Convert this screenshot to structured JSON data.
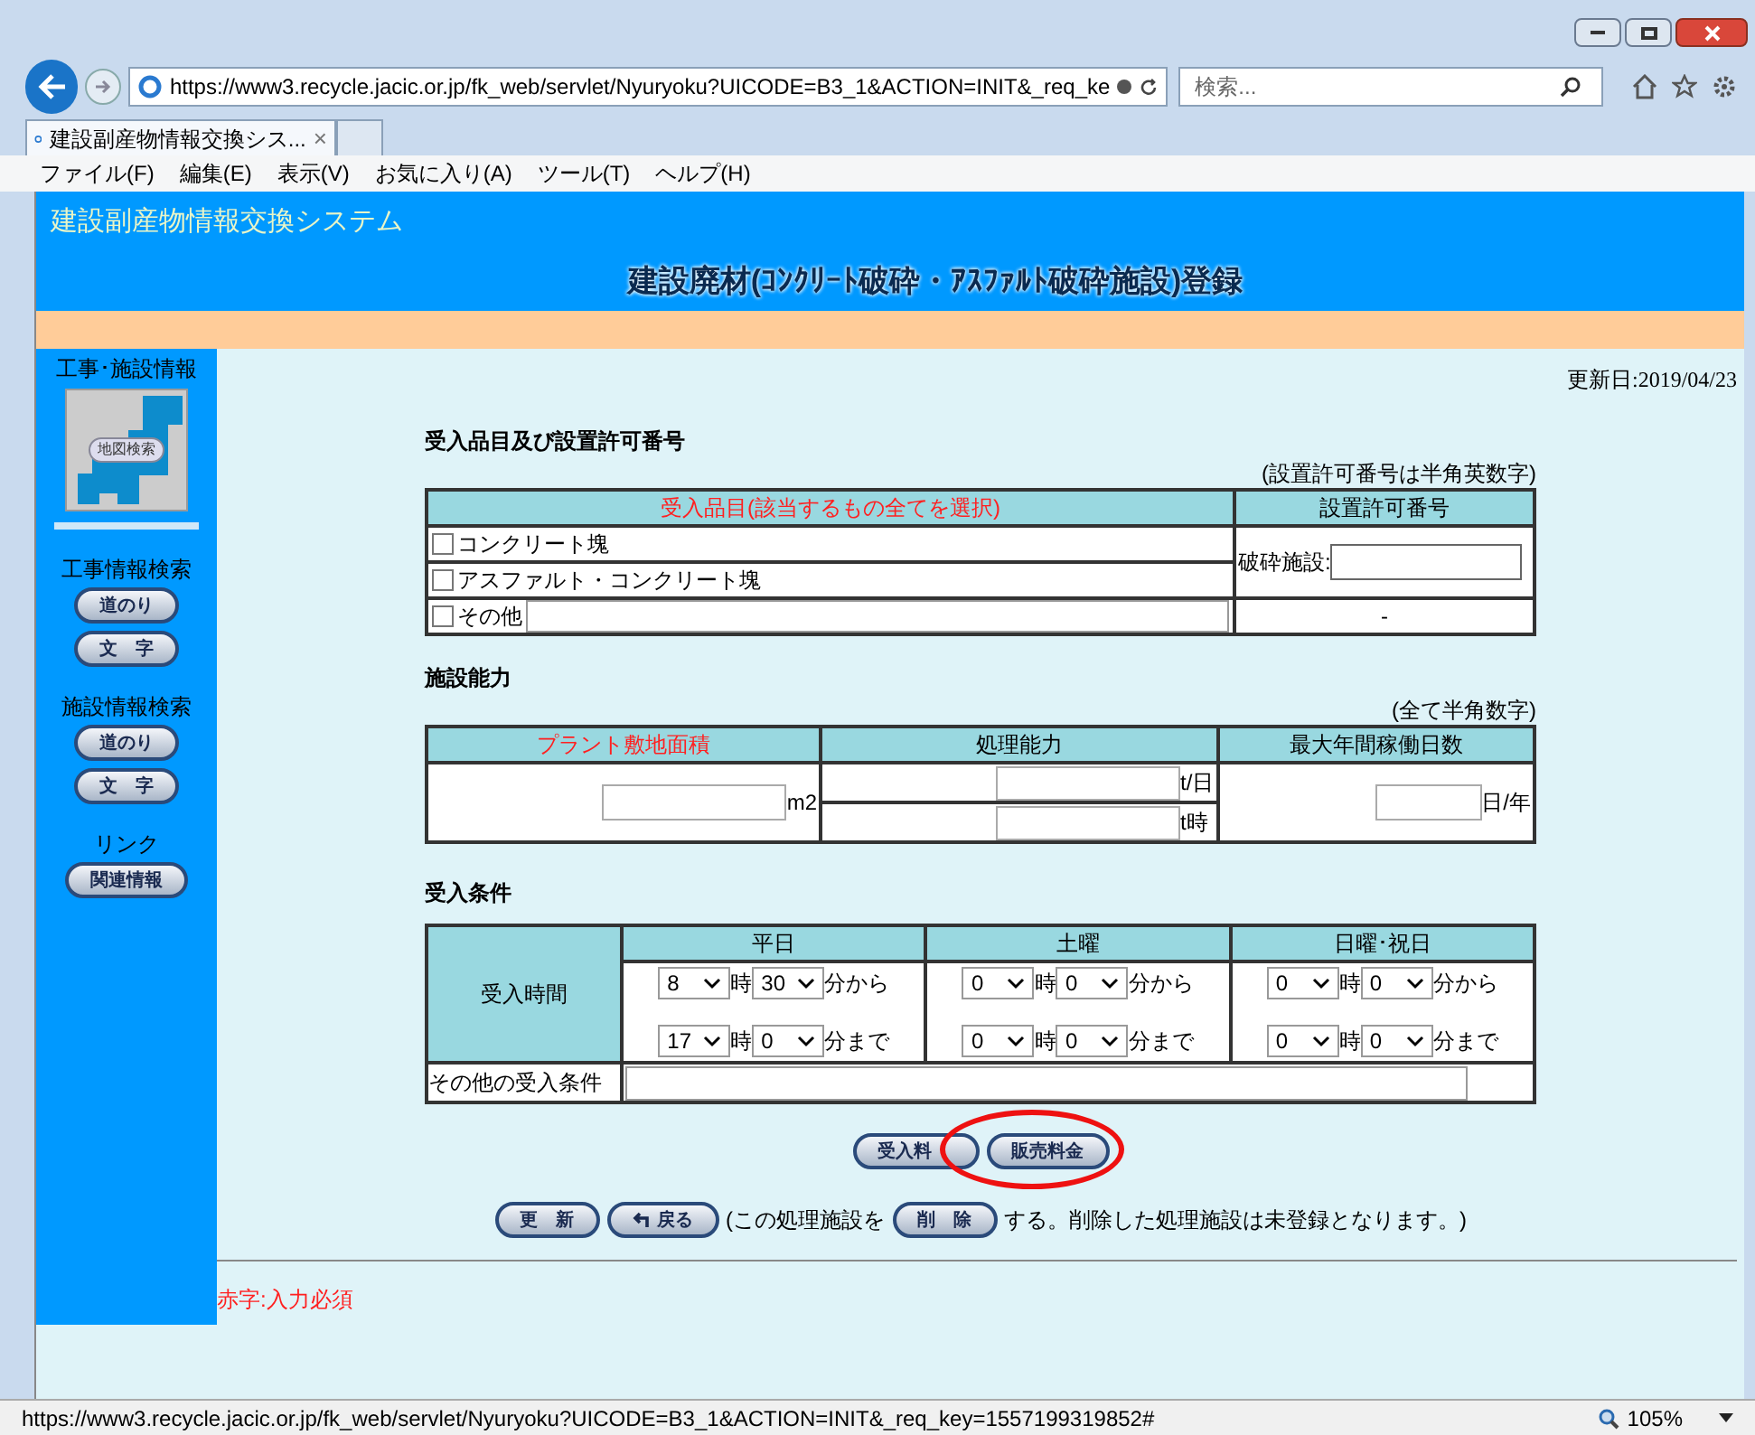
{
  "browser": {
    "address": "https://www3.recycle.jacic.or.jp/fk_web/servlet/Nyuryoku?UICODE=B3_1&ACTION=INIT&_req_ke",
    "search_placeholder": "検索...",
    "tab_title": "建設副産物情報交換シス...",
    "tab_close": "×",
    "menu": [
      "ファイル(F)",
      "編集(E)",
      "表示(V)",
      "お気に入り(A)",
      "ツール(T)",
      "ヘルプ(H)"
    ],
    "status_url": "https://www3.recycle.jacic.or.jp/fk_web/servlet/Nyuryoku?UICODE=B3_1&ACTION=INIT&_req_key=1557199319852#",
    "zoom": "105%"
  },
  "page": {
    "system_title": "建設副産物情報交換システム",
    "page_title": "建設廃材(ｺﾝｸﾘｰﾄ破砕・ｱｽﾌｧﾙﾄ破砕施設)登録",
    "updated": "更新日:2019/04/23"
  },
  "sidebar": {
    "heading": "工事･施設情報",
    "map_button": "地図検索",
    "groups": [
      {
        "title": "工事情報検索",
        "buttons": [
          "道のり",
          "文　字"
        ]
      },
      {
        "title": "施設情報検索",
        "buttons": [
          "道のり",
          "文　字"
        ]
      },
      {
        "title": "リンク",
        "buttons": [
          "関連情報"
        ]
      }
    ]
  },
  "items_section": {
    "title": "受入品目及び設置許可番号",
    "note": "(設置許可番号は半角英数字)",
    "columns": [
      {
        "label": "受入品目(該当するもの全てを選択)",
        "required": true
      },
      {
        "label": "設置許可番号",
        "required": false
      }
    ],
    "items": [
      {
        "label": "コンクリート塊",
        "checked": false,
        "kind": "plain"
      },
      {
        "label": "アスファルト・コンクリート塊",
        "checked": false,
        "kind": "plain"
      },
      {
        "label": "その他",
        "checked": false,
        "kind": "input"
      }
    ],
    "permit_label": "破砕施設:",
    "other_permit": "-"
  },
  "capacity_section": {
    "title": "施設能力",
    "note": "(全て半角数字)",
    "columns": [
      {
        "label": "プラント敷地面積",
        "required": true
      },
      {
        "label": "処理能力",
        "required": false
      },
      {
        "label": "最大年間稼働日数",
        "required": false
      }
    ],
    "area_unit": "m2",
    "capacity_units": [
      "t/日",
      "t時"
    ],
    "days_unit": "日/年"
  },
  "conditions_section": {
    "title": "受入条件",
    "row_label": "受入時間",
    "days": [
      {
        "label": "平日",
        "rows": [
          {
            "hour": "8",
            "hour_suffix": "時",
            "minute": "30",
            "suffix": "分から"
          },
          {
            "hour": "17",
            "hour_suffix": "時",
            "minute": "0",
            "suffix": "分まで"
          }
        ]
      },
      {
        "label": "土曜",
        "rows": [
          {
            "hour": "0",
            "hour_suffix": "時",
            "minute": "0",
            "suffix": "分から"
          },
          {
            "hour": "0",
            "hour_suffix": "時",
            "minute": "0",
            "suffix": "分まで"
          }
        ]
      },
      {
        "label": "日曜･祝日",
        "rows": [
          {
            "hour": "0",
            "hour_suffix": "時",
            "minute": "0",
            "suffix": "分から"
          },
          {
            "hour": "0",
            "hour_suffix": "時",
            "minute": "0",
            "suffix": "分まで"
          }
        ]
      }
    ],
    "other_label": "その他の受入条件"
  },
  "fee_buttons": [
    {
      "label": "受入料",
      "circled": false
    },
    {
      "label": "販売料金",
      "circled": true
    }
  ],
  "actions": {
    "update": "更　新",
    "back": "戻る",
    "text_before": "(この処理施設を",
    "delete": "削　除",
    "text_after": "する。削除した処理施設は未登録となります。)"
  },
  "footer_note": "赤字:入力必須"
}
